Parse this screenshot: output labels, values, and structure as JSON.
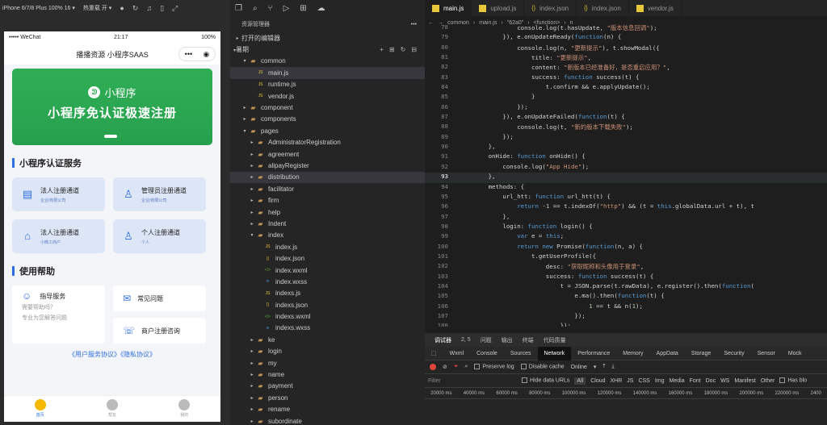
{
  "simulator": {
    "device_label": "iPhone 6/7/8 Plus 100% 16 ▾",
    "hotreload_label": "热重载 开 ▾",
    "status": {
      "carrier": "••••• WeChat",
      "time": "21:17",
      "battery": "100%"
    },
    "nav_title": "播播资源 小程序SAAS",
    "capsule": {
      "more": "•••",
      "close": "◉"
    },
    "banner": {
      "logo_text": "小程序",
      "logo_mark": "ᕲ",
      "headline": "小程序免认证极速注册"
    },
    "section1_title": "小程序认证服务",
    "cards": [
      {
        "title": "法人注册通道",
        "sub": "企业/有限公司",
        "icon": "id-card-icon",
        "glyph": "▤"
      },
      {
        "title": "管理员注册通道",
        "sub": "企业/有限公司",
        "icon": "admin-user-icon",
        "glyph": "♙"
      },
      {
        "title": "法人注册通道",
        "sub": "小微工商户",
        "icon": "shop-icon",
        "glyph": "⌂"
      },
      {
        "title": "个人注册通道",
        "sub": "个人",
        "icon": "person-icon",
        "glyph": "♙"
      }
    ],
    "section2_title": "使用帮助",
    "help": {
      "guide": {
        "title": "指导服务",
        "sub1": "需要帮助吗？",
        "sub2": "专业为您解答问题"
      },
      "faq": "常见问题",
      "consult": "商户注册咨询"
    },
    "links": "《用户服务协议》《隐私协议》",
    "tabs": [
      {
        "label": "首页",
        "active": true
      },
      {
        "label": "帮友",
        "active": false
      },
      {
        "label": "我的",
        "active": false
      }
    ]
  },
  "explorer": {
    "title": "资源管理器",
    "more": "•••",
    "open_editors": "打开的编辑器",
    "root": "暑期",
    "tree": [
      {
        "depth": 1,
        "kind": "folder",
        "open": true,
        "name": "common"
      },
      {
        "depth": 2,
        "kind": "js",
        "name": "main.js",
        "selected": true
      },
      {
        "depth": 2,
        "kind": "js",
        "name": "runtime.js"
      },
      {
        "depth": 2,
        "kind": "js",
        "name": "vendor.js"
      },
      {
        "depth": 1,
        "kind": "folder",
        "open": false,
        "name": "component"
      },
      {
        "depth": 1,
        "kind": "folder",
        "open": false,
        "name": "components"
      },
      {
        "depth": 1,
        "kind": "folder",
        "open": true,
        "name": "pages"
      },
      {
        "depth": 2,
        "kind": "folder",
        "open": false,
        "name": "AdministratorRegistration"
      },
      {
        "depth": 2,
        "kind": "folder",
        "open": false,
        "name": "agreement"
      },
      {
        "depth": 2,
        "kind": "folder",
        "open": false,
        "name": "alipayRegister"
      },
      {
        "depth": 2,
        "kind": "folder",
        "open": false,
        "name": "distribution",
        "hover": true
      },
      {
        "depth": 2,
        "kind": "folder",
        "open": false,
        "name": "facilitator"
      },
      {
        "depth": 2,
        "kind": "folder",
        "open": false,
        "name": "firm"
      },
      {
        "depth": 2,
        "kind": "folder",
        "open": false,
        "name": "help"
      },
      {
        "depth": 2,
        "kind": "folder",
        "open": false,
        "name": "Indent"
      },
      {
        "depth": 2,
        "kind": "folder",
        "open": true,
        "name": "index"
      },
      {
        "depth": 3,
        "kind": "js",
        "name": "index.js"
      },
      {
        "depth": 3,
        "kind": "json",
        "name": "index.json"
      },
      {
        "depth": 3,
        "kind": "wxml",
        "name": "index.wxml"
      },
      {
        "depth": 3,
        "kind": "wxss",
        "name": "index.wxss"
      },
      {
        "depth": 3,
        "kind": "js",
        "name": "indexs.js"
      },
      {
        "depth": 3,
        "kind": "json",
        "name": "indexs.json"
      },
      {
        "depth": 3,
        "kind": "wxml",
        "name": "indexs.wxml"
      },
      {
        "depth": 3,
        "kind": "wxss",
        "name": "indexs.wxss"
      },
      {
        "depth": 2,
        "kind": "folder",
        "open": false,
        "name": "ke"
      },
      {
        "depth": 2,
        "kind": "folder",
        "open": false,
        "name": "login"
      },
      {
        "depth": 2,
        "kind": "folder",
        "open": false,
        "name": "my"
      },
      {
        "depth": 2,
        "kind": "folder",
        "open": false,
        "name": "name"
      },
      {
        "depth": 2,
        "kind": "folder",
        "open": false,
        "name": "payment"
      },
      {
        "depth": 2,
        "kind": "folder",
        "open": false,
        "name": "person"
      },
      {
        "depth": 2,
        "kind": "folder",
        "open": false,
        "name": "rename"
      },
      {
        "depth": 2,
        "kind": "folder",
        "open": false,
        "name": "subordinate"
      }
    ]
  },
  "editor": {
    "tabs": [
      {
        "label": "main.js",
        "kind": "js",
        "active": true
      },
      {
        "label": "upload.js",
        "kind": "js",
        "active": false
      },
      {
        "label": "index.json",
        "kind": "json",
        "active": false
      },
      {
        "label": "index.json",
        "kind": "json",
        "active": false
      },
      {
        "label": "vendor.js",
        "kind": "js",
        "active": false
      }
    ],
    "breadcrumb": [
      "common",
      "main.js",
      "\"62a0\"",
      "<function>",
      "n"
    ],
    "lines": [
      {
        "n": "78",
        "t": "                console.log(t.hasUpdate, \"版本信息回调\");"
      },
      {
        "n": "79",
        "t": "            }), e.onUpdateReady(function(n) {"
      },
      {
        "n": "80",
        "t": "                console.log(n, \"更新提示\"), t.showModal({"
      },
      {
        "n": "81",
        "t": "                    title: \"更新提示\","
      },
      {
        "n": "82",
        "t": "                    content: \"新版本已经准备好，是否重启应用？\","
      },
      {
        "n": "83",
        "t": "                    success: function success(t) {"
      },
      {
        "n": "84",
        "t": "                        t.confirm && e.applyUpdate();"
      },
      {
        "n": "85",
        "t": "                    }"
      },
      {
        "n": "86",
        "t": "                });"
      },
      {
        "n": "87",
        "t": "            }), e.onUpdateFailed(function(t) {"
      },
      {
        "n": "88",
        "t": "                console.log(t, \"新的版本下载失败\");"
      },
      {
        "n": "89",
        "t": "            });"
      },
      {
        "n": "90",
        "t": "        },"
      },
      {
        "n": "91",
        "t": "        onHide: function onHide() {"
      },
      {
        "n": "92",
        "t": "            console.log(\"App Hide\");"
      },
      {
        "n": "93",
        "t": "        },",
        "hl": true
      },
      {
        "n": "94",
        "t": "        methods: {"
      },
      {
        "n": "95",
        "t": "            url_htt: function url_htt(t) {"
      },
      {
        "n": "96",
        "t": "                return -1 == t.indexOf(\"http\") && (t = this.globalData.url + t), t"
      },
      {
        "n": "97",
        "t": "            },"
      },
      {
        "n": "98",
        "t": "            login: function login() {"
      },
      {
        "n": "99",
        "t": "                var e = this;"
      },
      {
        "n": "100",
        "t": "                return new Promise(function(n, a) {"
      },
      {
        "n": "101",
        "t": "                    t.getUserProfile({"
      },
      {
        "n": "102",
        "t": "                        desc: \"获取昵称和头像用于登录\","
      },
      {
        "n": "103",
        "t": "                        success: function success(t) {"
      },
      {
        "n": "104",
        "t": "                            t = JSON.parse(t.rawData), e.register().then(function("
      },
      {
        "n": "105",
        "t": "                                e.ma().then(function(t) {"
      },
      {
        "n": "106",
        "t": "                                    1 == t && n(1);"
      },
      {
        "n": "107",
        "t": "                                });"
      },
      {
        "n": "108",
        "t": "                            });"
      }
    ]
  },
  "devtools": {
    "panel_tabs": [
      "调试器",
      "2, 5",
      "问题",
      "输出",
      "终端",
      "代码质量"
    ],
    "tabs": [
      "Wxml",
      "Console",
      "Sources",
      "Network",
      "Performance",
      "Memory",
      "AppData",
      "Storage",
      "Security",
      "Sensor",
      "Mock"
    ],
    "active_tab": "Network",
    "preserve_log": "Preserve log",
    "disable_cache": "Disable cache",
    "online": "Online",
    "filter_placeholder": "Filter",
    "hide_data_urls": "Hide data URLs",
    "types": [
      "All",
      "Cloud",
      "XHR",
      "JS",
      "CSS",
      "Img",
      "Media",
      "Font",
      "Doc",
      "WS",
      "Manifest",
      "Other"
    ],
    "has_blocked": "Has blo",
    "timeline": [
      "20000 ms",
      "40000 ms",
      "60000 ms",
      "80000 ms",
      "100000 ms",
      "120000 ms",
      "140000 ms",
      "160000 ms",
      "180000 ms",
      "200000 ms",
      "220000 ms",
      "2400"
    ]
  }
}
